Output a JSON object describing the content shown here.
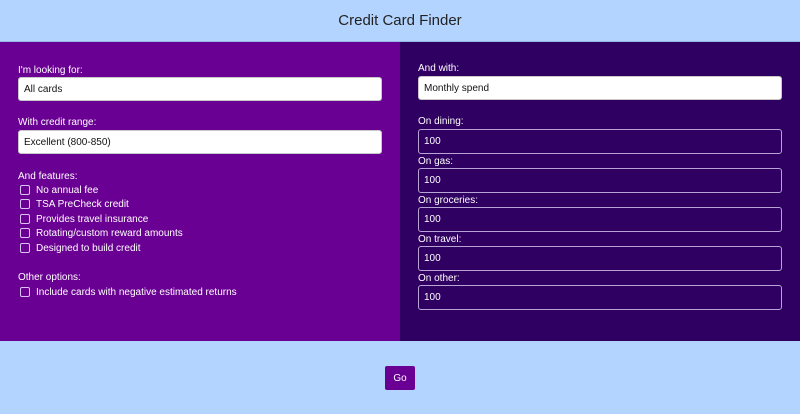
{
  "header": {
    "title": "Credit Card Finder"
  },
  "left": {
    "looking_for_label": "I'm looking for:",
    "looking_for_value": "All cards",
    "credit_range_label": "With credit range:",
    "credit_range_value": "Excellent (800-850)",
    "features_label": "And features:",
    "features": [
      "No annual fee",
      "TSA PreCheck credit",
      "Provides travel insurance",
      "Rotating/custom reward amounts",
      "Designed to build credit"
    ],
    "other_label": "Other options:",
    "other_options": [
      "Include cards with negative estimated returns"
    ]
  },
  "right": {
    "and_with_label": "And with:",
    "and_with_value": "Monthly spend",
    "spend": [
      {
        "label": "On dining:",
        "value": "100"
      },
      {
        "label": "On gas:",
        "value": "100"
      },
      {
        "label": "On groceries:",
        "value": "100"
      },
      {
        "label": "On travel:",
        "value": "100"
      },
      {
        "label": "On other:",
        "value": "100"
      }
    ]
  },
  "footer": {
    "go_label": "Go"
  },
  "colors": {
    "background": "#b3d4fe",
    "left_panel": "#6a0093",
    "right_panel": "#2f0062",
    "button": "#6a0093"
  }
}
